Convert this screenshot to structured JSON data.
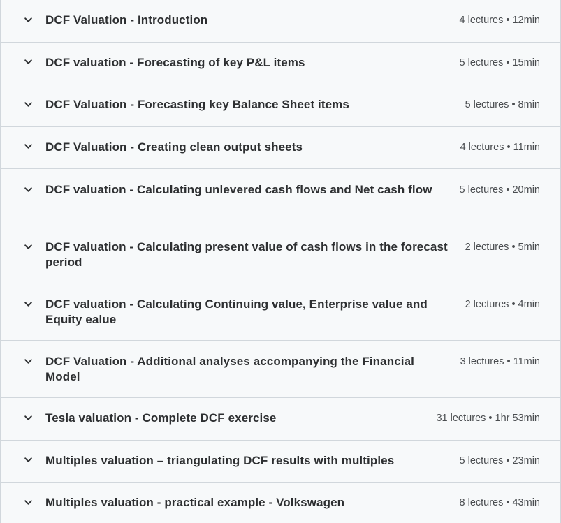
{
  "sections": [
    {
      "title": "DCF Valuation - Introduction",
      "meta": "4 lectures • 12min"
    },
    {
      "title": "DCF valuation - Forecasting of key P&L items",
      "meta": "5 lectures • 15min"
    },
    {
      "title": "DCF Valuation - Forecasting key Balance Sheet items",
      "meta": "5 lectures • 8min"
    },
    {
      "title": "DCF Valuation - Creating clean output sheets",
      "meta": "4 lectures • 11min"
    },
    {
      "title": "DCF valuation - Calculating unlevered cash flows and Net cash flow",
      "meta": "5 lectures • 20min"
    },
    {
      "title": "DCF valuation - Calculating present value of cash flows in the forecast period",
      "meta": "2 lectures • 5min"
    },
    {
      "title": "DCF valuation - Calculating Continuing value, Enterprise value and Equity ealue",
      "meta": "2 lectures • 4min"
    },
    {
      "title": "DCF Valuation - Additional analyses accompanying the Financial Model",
      "meta": "3 lectures • 11min"
    },
    {
      "title": "Tesla valuation - Complete DCF exercise",
      "meta": "31 lectures • 1hr 53min"
    },
    {
      "title": "Multiples valuation – triangulating DCF results with multiples",
      "meta": "5 lectures • 23min"
    },
    {
      "title": "Multiples valuation - practical example - Volkswagen",
      "meta": "8 lectures • 43min"
    }
  ],
  "icons": {
    "expand": "chevron-down-icon"
  }
}
